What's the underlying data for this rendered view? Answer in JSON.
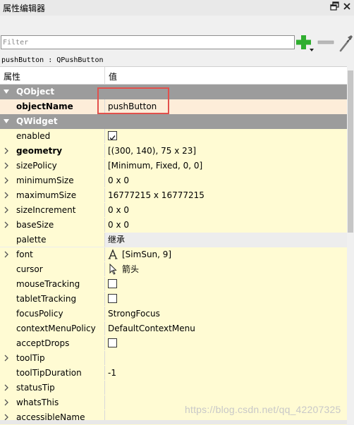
{
  "dock": {
    "title": "属性编辑器"
  },
  "filter": {
    "placeholder": "Filter",
    "value": ""
  },
  "object_label": "pushButton : QPushButton",
  "header": {
    "property": "属性",
    "value": "值"
  },
  "rows": [
    {
      "kind": "section",
      "name": "QObject"
    },
    {
      "kind": "prop",
      "name": "objectName",
      "value": "pushButton",
      "bold": true,
      "style": "orange"
    },
    {
      "kind": "section",
      "name": "QWidget"
    },
    {
      "kind": "prop",
      "name": "enabled",
      "type": "checkbox",
      "checked": true
    },
    {
      "kind": "prop",
      "name": "geometry",
      "value": "[(300, 140), 75 x 23]",
      "bold": true,
      "expandable": true
    },
    {
      "kind": "prop",
      "name": "sizePolicy",
      "value": "[Minimum, Fixed, 0, 0]",
      "expandable": true
    },
    {
      "kind": "prop",
      "name": "minimumSize",
      "value": "0 x 0",
      "expandable": true
    },
    {
      "kind": "prop",
      "name": "maximumSize",
      "value": "16777215 x 16777215",
      "expandable": true
    },
    {
      "kind": "prop",
      "name": "sizeIncrement",
      "value": "0 x 0",
      "expandable": true
    },
    {
      "kind": "prop",
      "name": "baseSize",
      "value": "0 x 0",
      "expandable": true
    },
    {
      "kind": "prop",
      "name": "palette",
      "value": "继承",
      "style": "grey"
    },
    {
      "kind": "prop",
      "name": "font",
      "value": "[SimSun, 9]",
      "icon": "font-icon",
      "expandable": true
    },
    {
      "kind": "prop",
      "name": "cursor",
      "value": "箭头",
      "icon": "cursor-arrow-icon"
    },
    {
      "kind": "prop",
      "name": "mouseTracking",
      "type": "checkbox",
      "checked": false
    },
    {
      "kind": "prop",
      "name": "tabletTracking",
      "type": "checkbox",
      "checked": false
    },
    {
      "kind": "prop",
      "name": "focusPolicy",
      "value": "StrongFocus"
    },
    {
      "kind": "prop",
      "name": "contextMenuPolicy",
      "value": "DefaultContextMenu"
    },
    {
      "kind": "prop",
      "name": "acceptDrops",
      "type": "checkbox",
      "checked": false
    },
    {
      "kind": "prop",
      "name": "toolTip",
      "value": "",
      "expandable": true
    },
    {
      "kind": "prop",
      "name": "toolTipDuration",
      "value": "-1"
    },
    {
      "kind": "prop",
      "name": "statusTip",
      "value": "",
      "expandable": true
    },
    {
      "kind": "prop",
      "name": "whatsThis",
      "value": "",
      "expandable": true
    },
    {
      "kind": "prop",
      "name": "accessibleName",
      "value": "",
      "expandable": true
    }
  ],
  "watermark": "https://blog.csdn.net/qq_42207325",
  "colors": {
    "section_bg": "#9c9c9c",
    "row_bg": "#fffbd3",
    "selected_row_bg": "#fdedd9",
    "highlight_border": "#e2504c",
    "add_icon": "#2fae2f"
  }
}
